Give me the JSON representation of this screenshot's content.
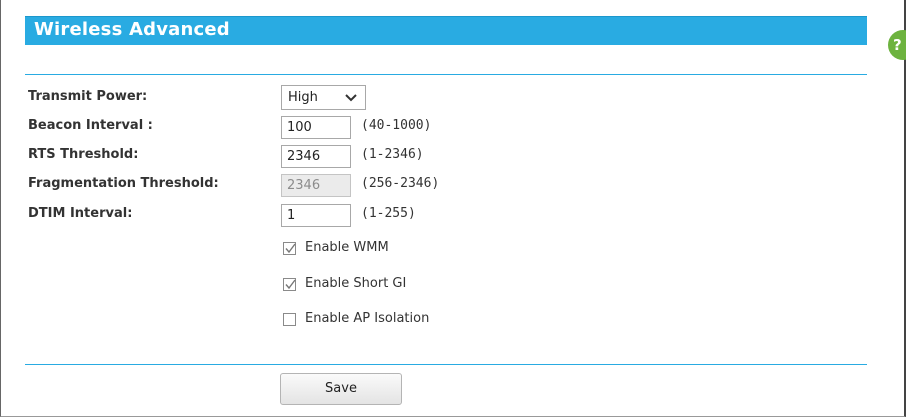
{
  "header": {
    "title": "Wireless Advanced",
    "help_glyph": "?",
    "accent_color": "#29abe2"
  },
  "form": {
    "transmit_power": {
      "label": "Transmit Power:",
      "selected": "High"
    },
    "beacon_interval": {
      "label": "Beacon Interval :",
      "value": "100",
      "range": "(40-1000)"
    },
    "rts_threshold": {
      "label": "RTS Threshold:",
      "value": "2346",
      "range": "(1-2346)"
    },
    "fragmentation_threshold": {
      "label": "Fragmentation Threshold:",
      "value": "2346",
      "range": "(256-2346)",
      "disabled": true
    },
    "dtim_interval": {
      "label": "DTIM Interval:",
      "value": "1",
      "range": "(1-255)"
    },
    "checkboxes": [
      {
        "label": "Enable WMM",
        "checked": true
      },
      {
        "label": "Enable Short GI",
        "checked": true
      },
      {
        "label": "Enable AP Isolation",
        "checked": false
      }
    ]
  },
  "actions": {
    "save_label": "Save"
  },
  "icons": {
    "help": "help-icon",
    "dropdown": "chevron-down-icon",
    "check": "checkmark-icon"
  }
}
